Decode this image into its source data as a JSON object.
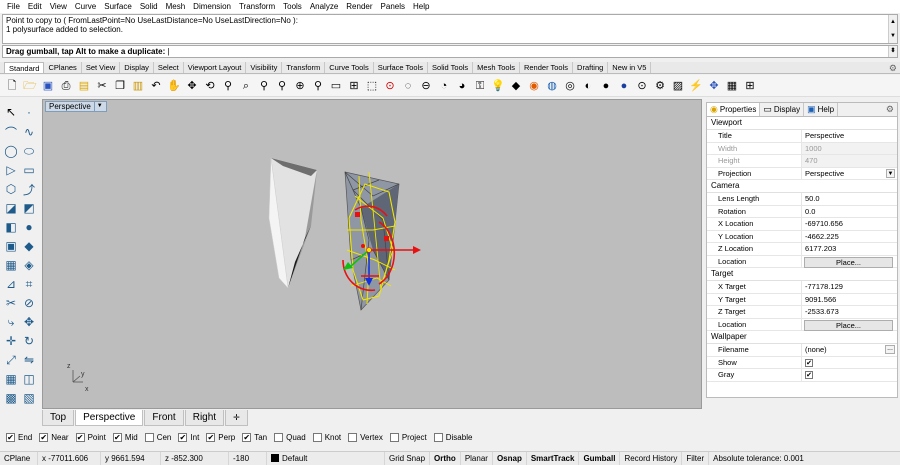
{
  "menubar": [
    "File",
    "Edit",
    "View",
    "Curve",
    "Surface",
    "Solid",
    "Mesh",
    "Dimension",
    "Transform",
    "Tools",
    "Analyze",
    "Render",
    "Panels",
    "Help"
  ],
  "history": [
    "Point to copy to ( FromLastPoint=No  UseLastDistance=No  UseLastDirection=No ):",
    "1 polysurface added to selection."
  ],
  "command_prompt": "Drag gumball, tap Alt to make a duplicate:",
  "toolbar_tabs": [
    "Standard",
    "CPlanes",
    "Set View",
    "Display",
    "Select",
    "Viewport Layout",
    "Visibility",
    "Transform",
    "Curve Tools",
    "Surface Tools",
    "Solid Tools",
    "Mesh Tools",
    "Render Tools",
    "Drafting",
    "New in V5"
  ],
  "toolbar_icons": [
    "new-file-icon",
    "open-file-icon",
    "save-icon",
    "print-icon",
    "import-icon",
    "cut-icon",
    "copy-icon",
    "paste-icon",
    "undo-icon",
    "pan-icon",
    "rotate-view-icon",
    "zoom-icon",
    "zoom-window-icon",
    "zoom-extents-icon",
    "zoom-selected-icon",
    "named-views-icon",
    "viewport-layout-icon",
    "four-view-icon",
    "cplane-icon",
    "osnap-icon",
    "layer-icon",
    "select-icon",
    "hide-icon",
    "show-icon",
    "lock-icon",
    "light-icon",
    "material-icon",
    "color-wheel-icon",
    "render-icon",
    "preview-icon",
    "shade-icon",
    "sphere-icon",
    "render-sphere-icon",
    "options-icon",
    "gear-icon",
    "help-icon",
    "move-icon",
    "lightning-icon",
    "properties-icon"
  ],
  "viewport": {
    "title": "Perspective",
    "axis_x": "x",
    "axis_y": "y",
    "axis_z": "z"
  },
  "viewport_tabs": [
    "Top",
    "Perspective",
    "Front",
    "Right"
  ],
  "viewport_tab_active": "Perspective",
  "osnaps": [
    {
      "label": "End",
      "checked": true
    },
    {
      "label": "Near",
      "checked": true
    },
    {
      "label": "Point",
      "checked": true
    },
    {
      "label": "Mid",
      "checked": true
    },
    {
      "label": "Cen",
      "checked": false
    },
    {
      "label": "Int",
      "checked": true
    },
    {
      "label": "Perp",
      "checked": true
    },
    {
      "label": "Tan",
      "checked": true
    },
    {
      "label": "Quad",
      "checked": false
    },
    {
      "label": "Knot",
      "checked": false
    },
    {
      "label": "Vertex",
      "checked": false
    },
    {
      "label": "Project",
      "checked": false
    },
    {
      "label": "Disable",
      "checked": false
    }
  ],
  "status": {
    "cplane": "CPlane",
    "x": "x -77011.606",
    "y": "y 9661.594",
    "z": "z -852.300",
    "angle": "-180",
    "layer": "Default",
    "grid_snap": "Grid Snap",
    "ortho": "Ortho",
    "planar": "Planar",
    "osnap": "Osnap",
    "smarttrack": "SmartTrack",
    "gumball": "Gumball",
    "record_history": "Record History",
    "filter": "Filter",
    "tolerance": "Absolute tolerance: 0.001"
  },
  "panel": {
    "tabs": [
      "Properties",
      "Display",
      "Help"
    ],
    "sections": {
      "viewport": "Viewport",
      "camera": "Camera",
      "target": "Target",
      "wallpaper": "Wallpaper"
    },
    "viewport_rows": [
      {
        "label": "Title",
        "value": "Perspective"
      },
      {
        "label": "Width",
        "value": "1000"
      },
      {
        "label": "Height",
        "value": "470"
      },
      {
        "label": "Projection",
        "value": "Perspective"
      }
    ],
    "camera_rows": [
      {
        "label": "Lens Length",
        "value": "50.0"
      },
      {
        "label": "Rotation",
        "value": "0.0"
      },
      {
        "label": "X Location",
        "value": "-69710.656"
      },
      {
        "label": "Y Location",
        "value": "-4662.225"
      },
      {
        "label": "Z Location",
        "value": "6177.203"
      },
      {
        "label": "Location",
        "value": "Place..."
      }
    ],
    "target_rows": [
      {
        "label": "X Target",
        "value": "-77178.129"
      },
      {
        "label": "Y Target",
        "value": "9091.566"
      },
      {
        "label": "Z Target",
        "value": "-2533.673"
      },
      {
        "label": "Location",
        "value": "Place..."
      }
    ],
    "wallpaper_rows": [
      {
        "label": "Filename",
        "value": "(none)"
      },
      {
        "label": "Show",
        "checked": true
      },
      {
        "label": "Gray",
        "checked": true
      }
    ],
    "more_button": "..."
  },
  "colors": {
    "viewport_bg": "#bdbdbd",
    "selection_yellow": "#f2e600",
    "gumball_red": "#e81010",
    "gumball_green": "#10c010",
    "gumball_blue": "#1030e0"
  }
}
